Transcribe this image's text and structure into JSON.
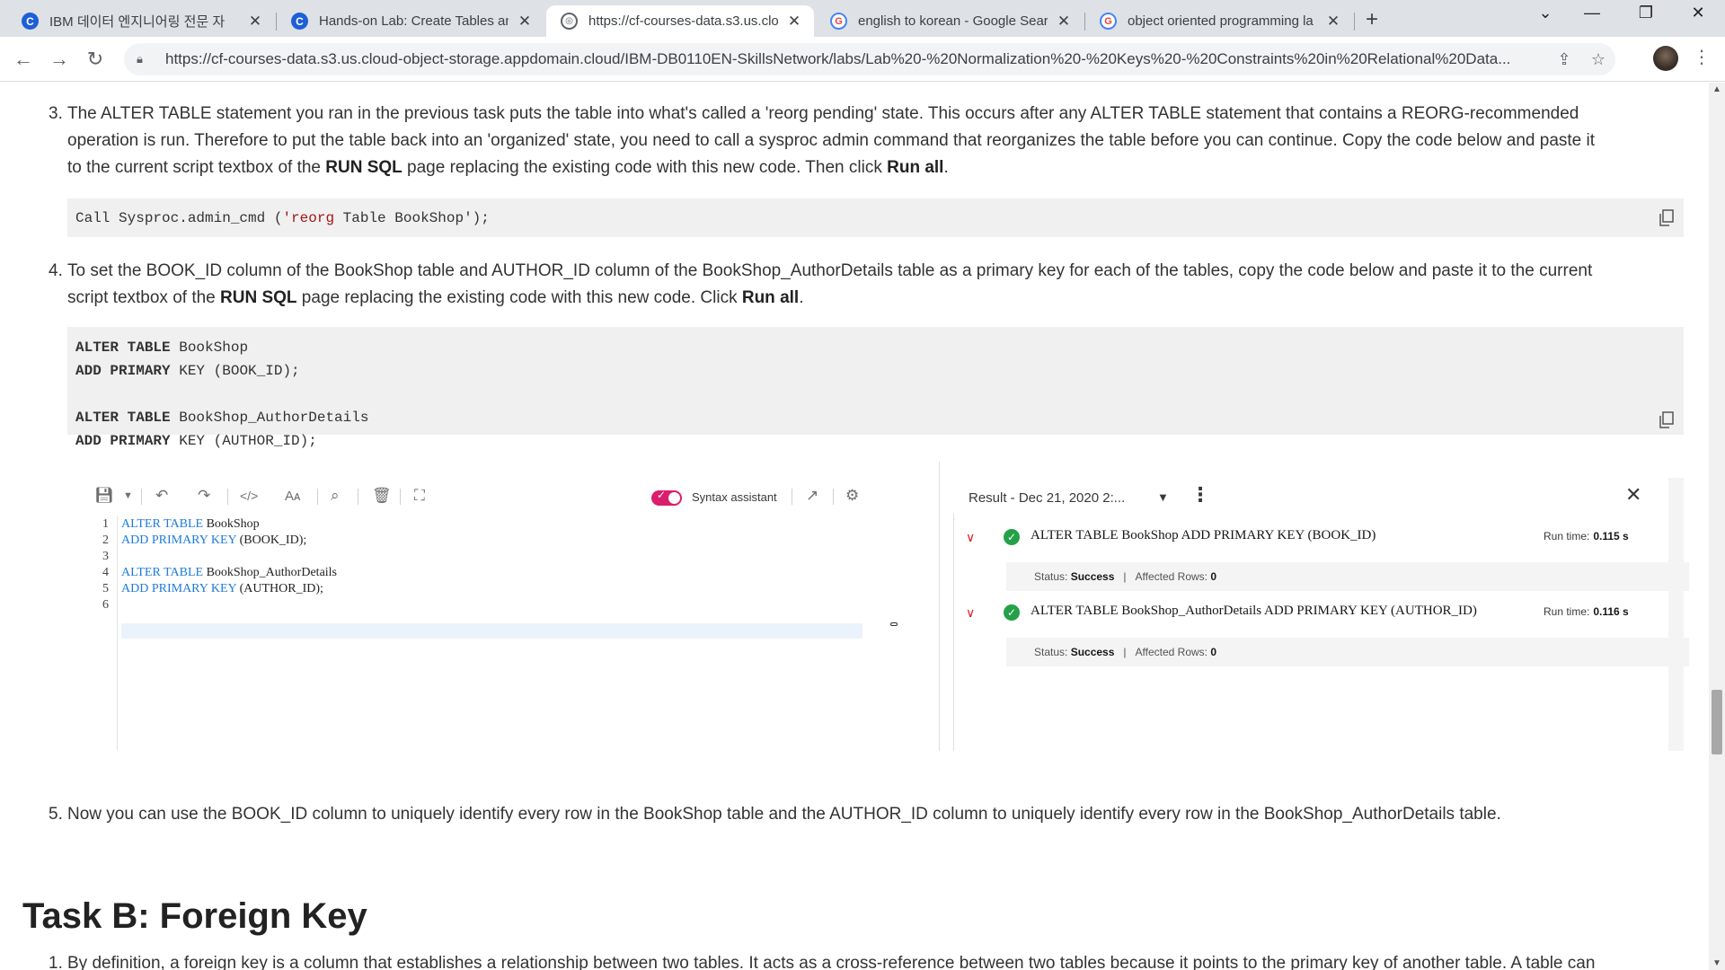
{
  "browser": {
    "tabs": [
      {
        "title": "IBM 데이터 엔지니어링 전문 자",
        "icon": "C"
      },
      {
        "title": "Hands-on Lab: Create Tables an",
        "icon": "C"
      },
      {
        "title": "https://cf-courses-data.s3.us.clo",
        "icon": "web"
      },
      {
        "title": "english to korean - Google Sear",
        "icon": "G"
      },
      {
        "title": "object oriented programming la",
        "icon": "G"
      }
    ],
    "url": "https://cf-courses-data.s3.us.cloud-object-storage.appdomain.cloud/IBM-DB0110EN-SkillsNetwork/labs/Lab%20-%20Normalization%20-%20Keys%20-%20Constraints%20in%20Relational%20Data..."
  },
  "steps": {
    "s3": {
      "num": "3.",
      "p1": "The ALTER TABLE statement you ran in the previous task puts the table into what's called a 'reorg pending' state. This occurs after any ALTER TABLE statement that contains a REORG-recommended",
      "p2": "operation is run. Therefore to put the table back into an 'organized' state, you need to call a sysproc admin command that reorganizes the table before you can continue. Copy the code below and paste it",
      "p3a": "to the current script textbox of the ",
      "p3b": "RUN SQL",
      "p3c": " page replacing the existing code with this new code. Then click ",
      "p3d": "Run all",
      "p3e": "."
    },
    "code3": {
      "a": "Call Sysproc.admin_cmd (",
      "b": "'reorg",
      "c": " Table BookShop');"
    },
    "s4": {
      "num": "4.",
      "p1": "To set the BOOK_ID column of the BookShop table and AUTHOR_ID column of the BookShop_AuthorDetails table as a primary key for each of the tables, copy the code below and paste it to the current",
      "p2a": "script textbox of the ",
      "p2b": "RUN SQL",
      "p2c": " page replacing the existing code with this new code. Click ",
      "p2d": "Run all",
      "p2e": "."
    },
    "code4": {
      "l1kw": "ALTER TABLE",
      "l1": " BookShop",
      "l2kw": "ADD PRIMARY",
      "l2": " KEY (BOOK_ID);",
      "l4kw": "ALTER TABLE",
      "l4": " BookShop_AuthorDetails",
      "l5kw": "ADD PRIMARY",
      "l5": " KEY (AUTHOR_ID);"
    },
    "s5": {
      "num": "5.",
      "text": "Now you can use the BOOK_ID column to uniquely identify every row in the BookShop table and the AUTHOR_ID column to uniquely identify every row in the BookShop_AuthorDetails table."
    }
  },
  "tool": {
    "syntax_label": "Syntax assistant",
    "editor_lines": [
      {
        "n": "1",
        "kw": "ALTER TABLE",
        "rest": " BookShop"
      },
      {
        "n": "2",
        "kw": "ADD PRIMARY KEY",
        "rest": " (BOOK_ID);"
      },
      {
        "n": "3",
        "kw": "",
        "rest": ""
      },
      {
        "n": "4",
        "kw": "ALTER TABLE",
        "rest": " BookShop_AuthorDetails"
      },
      {
        "n": "5",
        "kw": "ADD PRIMARY KEY",
        "rest": " (AUTHOR_ID);"
      },
      {
        "n": "6",
        "kw": "",
        "rest": ""
      }
    ],
    "result_title": "Result - Dec 21, 2020 2:...",
    "results": [
      {
        "stmt": "ALTER TABLE BookShop ADD PRIMARY KEY (BOOK_ID)",
        "runtime_label": "Run time:",
        "runtime": "0.115 s",
        "status_label": "Status:",
        "status": "Success",
        "rows_label": "Affected Rows:",
        "rows": "0"
      },
      {
        "stmt": "ALTER TABLE BookShop_AuthorDetails ADD PRIMARY KEY (AUTHOR_ID)",
        "runtime_label": "Run time:",
        "runtime": "0.116 s",
        "status_label": "Status:",
        "status": "Success",
        "rows_label": "Affected Rows:",
        "rows": "0"
      }
    ]
  },
  "task_b": {
    "heading": "Task B: Foreign Key",
    "s1_num": "1.",
    "s1_text": "By definition, a foreign key is a column that establishes a relationship between two tables. It acts as a cross-reference between two tables because it points to the primary key of another table. A table can"
  },
  "colors": {
    "accent_toggle": "#da1e6b",
    "success": "#24a148",
    "sql_keyword": "#1f7bd8",
    "code_bg": "#f0f0f0"
  }
}
